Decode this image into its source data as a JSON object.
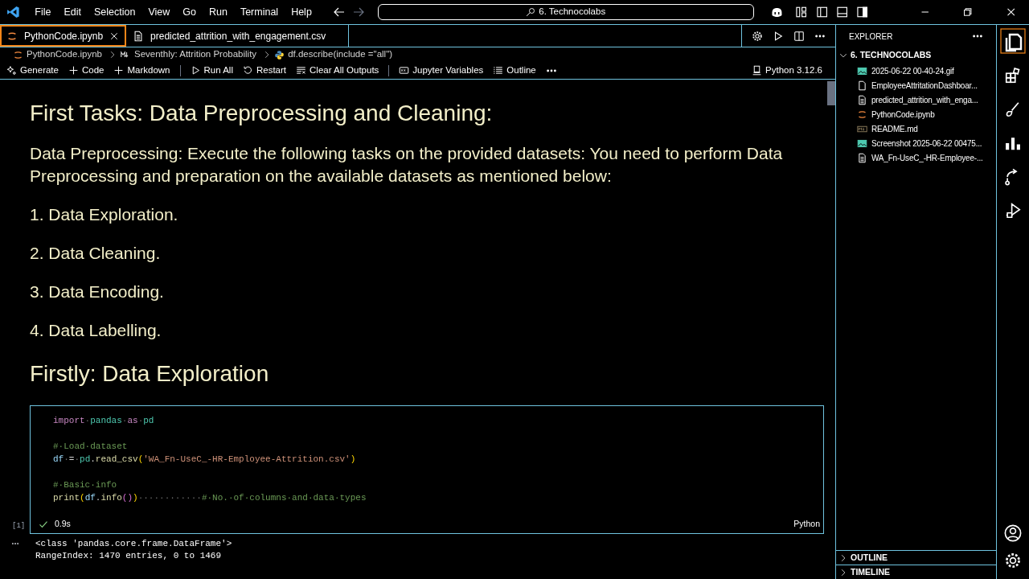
{
  "menu": [
    "File",
    "Edit",
    "Selection",
    "View",
    "Go",
    "Run",
    "Terminal",
    "Help"
  ],
  "command_center": "6. Technocolabs",
  "tabs": [
    {
      "label": "PythonCode.ipynb",
      "kind": "notebook",
      "selected": true
    },
    {
      "label": "predicted_attrition_with_engagement.csv",
      "kind": "csv",
      "selected": false
    }
  ],
  "breadcrumb": [
    {
      "label": "PythonCode.ipynb",
      "kind": "notebook"
    },
    {
      "label": "Seventhly: Attrition Probability",
      "kind": "markdown"
    },
    {
      "label": "df.describe(include =\"all\")",
      "kind": "python"
    }
  ],
  "toolbar": [
    {
      "label": "Generate",
      "kind": "sparkle"
    },
    {
      "label": "Code",
      "kind": "plus"
    },
    {
      "label": "Markdown",
      "kind": "plus"
    },
    {
      "label": "Run All",
      "kind": "run"
    },
    {
      "label": "Restart",
      "kind": "restart"
    },
    {
      "label": "Clear All Outputs",
      "kind": "clear"
    },
    {
      "label": "Jupyter Variables",
      "kind": "variables"
    },
    {
      "label": "Outline",
      "kind": "list"
    }
  ],
  "kernel": "Python 3.12.6",
  "markdown": [
    {
      "kind": "h1",
      "text": "First Tasks: Data Preprocessing and Cleaning:"
    },
    {
      "kind": "p",
      "text": "Data Preprocessing: Execute the following tasks on the provided datasets: You need to perform Data Preprocessing and preparation on the available datasets as mentioned below:"
    },
    {
      "kind": "p",
      "text": "1. Data Exploration."
    },
    {
      "kind": "p",
      "text": "2. Data Cleaning."
    },
    {
      "kind": "p",
      "text": "3. Data Encoding."
    },
    {
      "kind": "p",
      "text": "4. Data Labelling."
    },
    {
      "kind": "h1",
      "text": "Firstly: Data Exploration"
    }
  ],
  "code_cell": {
    "execution_count": "[1]",
    "status": "0.9s",
    "language": "Python",
    "blocks": [
      [
        [
          {
            "kind": "keyword",
            "text": "import"
          },
          {
            "kind": "space",
            "text": "·"
          },
          {
            "kind": "module",
            "text": "pandas"
          },
          {
            "kind": "space",
            "text": "·"
          },
          {
            "kind": "keyword",
            "text": "as"
          },
          {
            "kind": "space",
            "text": "·"
          },
          {
            "kind": "module",
            "text": "pd"
          }
        ]
      ],
      [
        [
          {
            "kind": "comment",
            "text": "#·Load·dataset"
          }
        ],
        [
          {
            "kind": "variable",
            "text": "df"
          },
          {
            "kind": "space",
            "text": "·"
          },
          {
            "kind": "op",
            "text": "="
          },
          {
            "kind": "space",
            "text": "·"
          },
          {
            "kind": "module",
            "text": "pd"
          },
          {
            "kind": "op",
            "text": "."
          },
          {
            "kind": "function",
            "text": "read_csv"
          },
          {
            "kind": "bracket",
            "text": "("
          },
          {
            "kind": "string",
            "text": "'WA_Fn-UseC_-HR-Employee-Attrition.csv'"
          },
          {
            "kind": "bracket",
            "text": ")"
          }
        ]
      ],
      [
        [
          {
            "kind": "comment",
            "text": "#·Basic·info"
          }
        ],
        [
          {
            "kind": "function",
            "text": "print"
          },
          {
            "kind": "bracket",
            "text": "("
          },
          {
            "kind": "variable",
            "text": "df"
          },
          {
            "kind": "op",
            "text": "."
          },
          {
            "kind": "function",
            "text": "info"
          },
          {
            "kind": "bracket2",
            "text": "()"
          },
          {
            "kind": "bracket",
            "text": ")"
          },
          {
            "kind": "space",
            "text": "············"
          },
          {
            "kind": "comment",
            "text": "#·No.·of·columns·and·data·types"
          }
        ]
      ]
    ]
  },
  "output": [
    "<class 'pandas.core.frame.DataFrame'>",
    "RangeIndex: 1470 entries, 0 to 1469"
  ],
  "explorer": {
    "title": "EXPLORER",
    "folder": "6. TECHNOCOLABS",
    "expanded": true,
    "files": [
      {
        "name": "2025-06-22 00-40-24.gif",
        "kind": "image"
      },
      {
        "name": "EmployeeAttritationDashboar...",
        "kind": "file"
      },
      {
        "name": "predicted_attrition_with_enga...",
        "kind": "csv"
      },
      {
        "name": "PythonCode.ipynb",
        "kind": "notebook"
      },
      {
        "name": "README.md",
        "kind": "markdown"
      },
      {
        "name": "Screenshot 2025-06-22 00475...",
        "kind": "image"
      },
      {
        "name": "WA_Fn-UseC_-HR-Employee-...",
        "kind": "csv"
      }
    ]
  },
  "panels": [
    {
      "label": "OUTLINE",
      "expanded": false
    },
    {
      "label": "TIMELINE",
      "expanded": false
    }
  ]
}
